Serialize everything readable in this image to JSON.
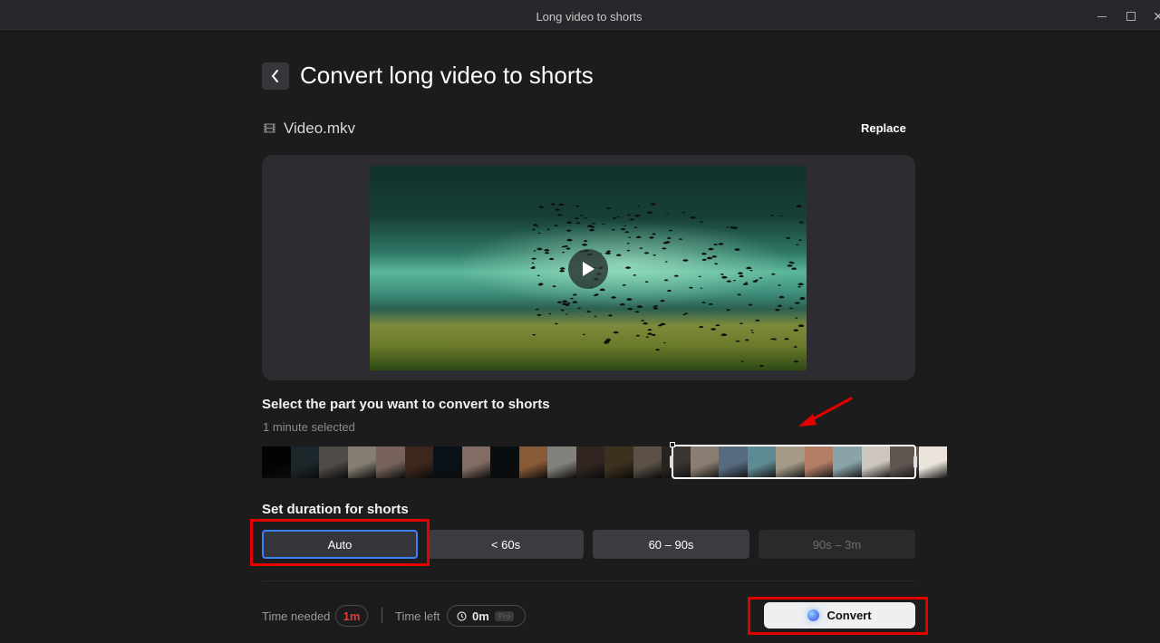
{
  "window": {
    "title": "Long video to shorts",
    "controls": [
      "minimize",
      "maximize",
      "close"
    ]
  },
  "header": {
    "back_icon": "chevron-left-icon",
    "title": "Convert long video to shorts"
  },
  "file": {
    "icon": "film-icon",
    "name": "Video.mkv",
    "replace_label": "Replace"
  },
  "preview": {
    "play_icon": "play-icon"
  },
  "selection": {
    "heading": "Select the part you want to convert to shorts",
    "status": "1 minute selected",
    "frame_colors": [
      "#050505",
      "#2c3d44",
      "#7a746c",
      "#c9c0b0",
      "#b7998b",
      "#5e3d2c",
      "#0f1c26",
      "#c7a89a",
      "#0d1619",
      "#d38a55",
      "#c9c6be",
      "#4a3a32",
      "#5e4a2e",
      "#8c7d6e",
      "#3b3631",
      "#8a7d72",
      "#566a80",
      "#5e8a94",
      "#a59a88",
      "#b37d66",
      "#8aa3a8",
      "#ccc6be",
      "#5e5550",
      "#eae4dc"
    ]
  },
  "duration": {
    "heading": "Set duration for shorts",
    "options": [
      {
        "label": "Auto",
        "state": "selected"
      },
      {
        "label": "< 60s",
        "state": "normal"
      },
      {
        "label": "60 – 90s",
        "state": "normal"
      },
      {
        "label": "90s – 3m",
        "state": "disabled"
      }
    ]
  },
  "footer": {
    "time_needed_label": "Time needed",
    "time_needed_value": "1m",
    "time_left_label": "Time left",
    "time_left_icon": "clock-icon",
    "time_left_value": "0m",
    "pro_badge": "Pro",
    "convert_label": "Convert"
  },
  "colors": {
    "accent_blue": "#3b82f6",
    "alert_red": "#e03c3c",
    "annotation_red": "#e50000"
  }
}
